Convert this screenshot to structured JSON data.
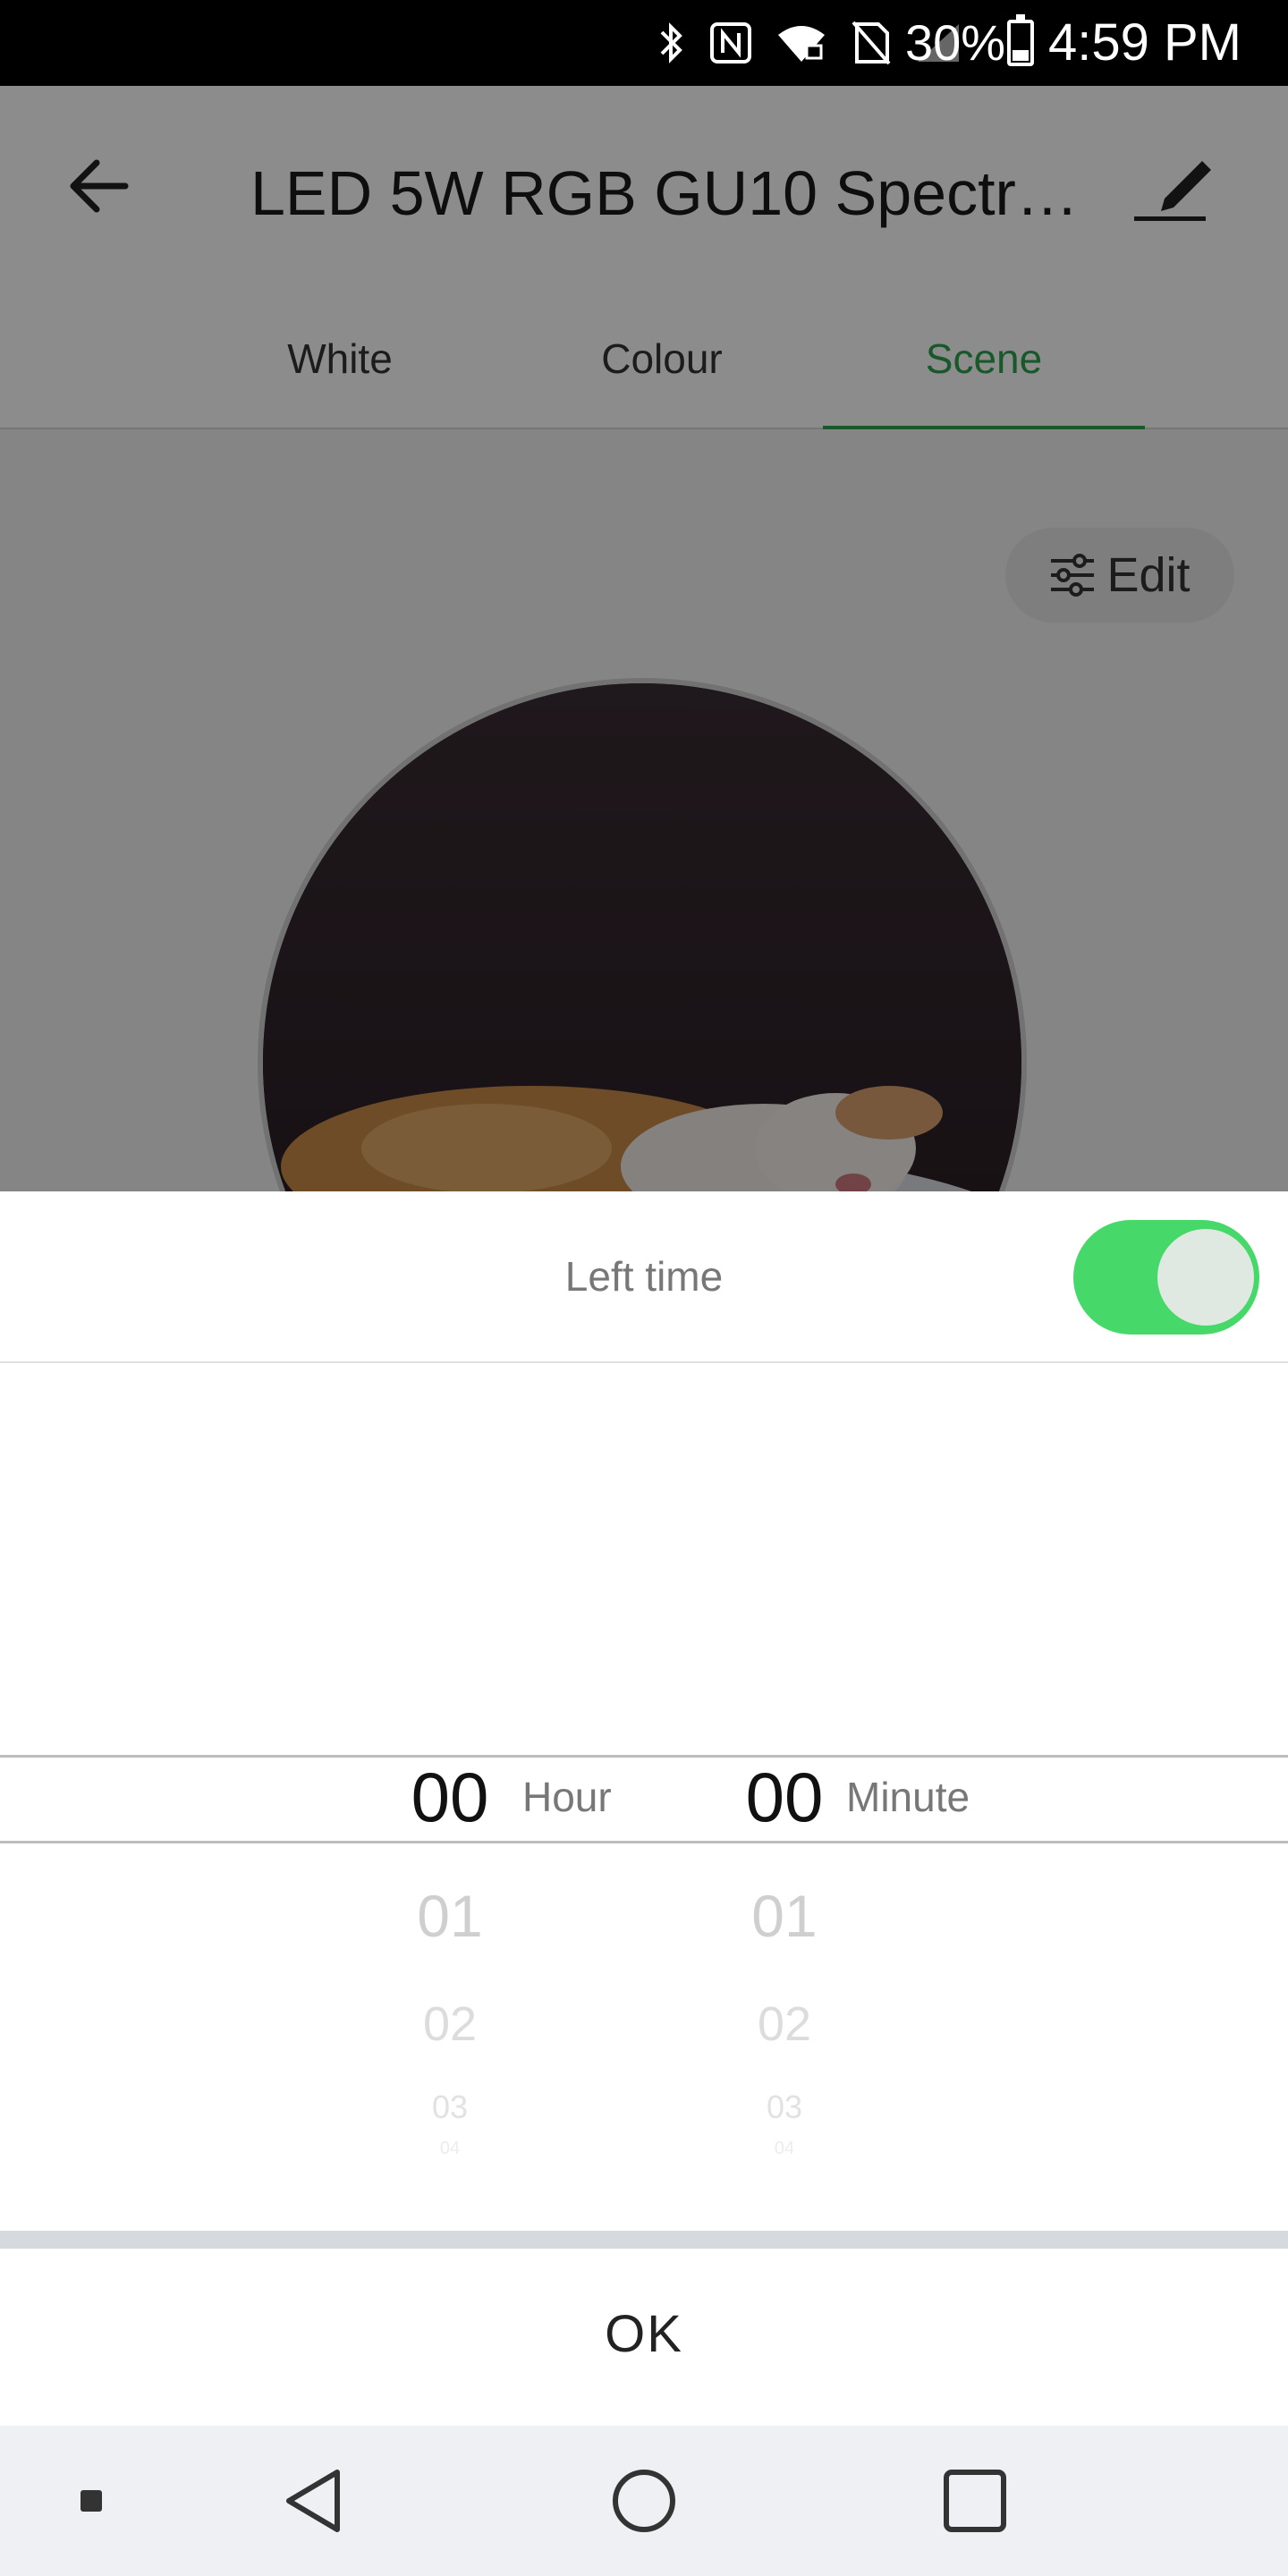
{
  "status_bar": {
    "battery": "30%",
    "time": "4:59 PM",
    "icons": [
      "bluetooth-icon",
      "nfc-icon",
      "wifi-icon",
      "no-sim-icon",
      "signal-icon",
      "battery-icon"
    ]
  },
  "header": {
    "title": "LED 5W RGB GU10 Spectr…",
    "back_icon": "arrow-left-icon",
    "edit_icon": "pencil-icon"
  },
  "tabs": [
    {
      "label": "White",
      "active": false
    },
    {
      "label": "Colour",
      "active": false
    },
    {
      "label": "Scene",
      "active": true
    }
  ],
  "scene": {
    "edit_label": "Edit",
    "edit_icon": "sliders-icon",
    "image": "sleeping-kitten"
  },
  "sheet": {
    "title": "Left time",
    "toggle_on": true,
    "hours": [
      "00",
      "01",
      "02",
      "03",
      "04"
    ],
    "minutes": [
      "00",
      "01",
      "02",
      "03",
      "04"
    ],
    "hour_label": "Hour",
    "minute_label": "Minute",
    "ok_label": "OK"
  },
  "colors": {
    "accent_green": "#2fa34c",
    "toggle_green": "#46d868"
  }
}
